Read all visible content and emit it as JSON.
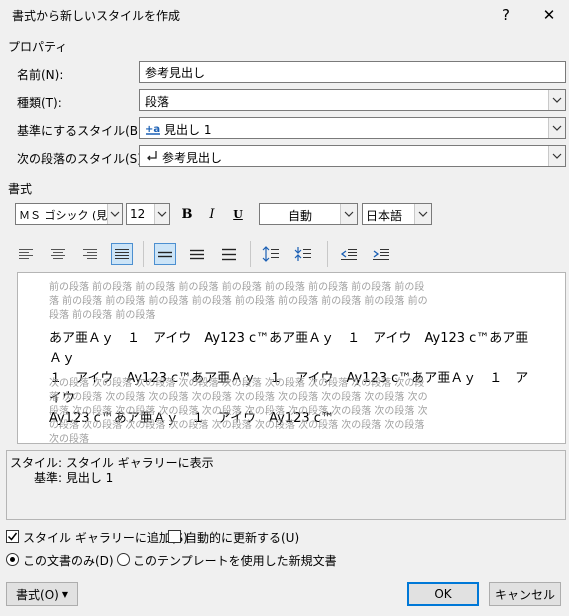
{
  "dialog": {
    "title": "書式から新しいスタイルを作成",
    "help": "?",
    "close": "✕"
  },
  "properties": {
    "heading": "プロパティ",
    "name_label": "名前(N):",
    "name_value": "参考見出し",
    "type_label": "種類(T):",
    "type_value": "段落",
    "based_on_label": "基準にするスタイル(B):",
    "based_on_value": "見出し 1",
    "next_label": "次の段落のスタイル(S):",
    "next_value": "参考見出し"
  },
  "formatting": {
    "heading": "書式",
    "font": "ＭＳ ゴシック (見出",
    "size": "12",
    "bold": "B",
    "italic": "I",
    "underline": "U",
    "color": "自動",
    "language": "日本語"
  },
  "preview": {
    "prev_para_lines": [
      "前の段落 前の段落 前の段落 前の段落 前の段落 前の段落 前の段落 前の段落 前の段",
      "落 前の段落 前の段落 前の段落 前の段落 前の段落 前の段落 前の段落 前の段落 前の",
      "段落 前の段落 前の段落"
    ],
    "sample_lines": [
      "あア亜Ａｙ　１　アイウ　Ay123 c™あア亜Ａｙ　１　アイウ　Ay123 c™あア亜Ａｙ",
      "１　アイウ　Ay123 c™あア亜Ａｙ　１　アイウ　Ay123 c™あア亜Ａｙ　１　アイウ",
      "Ay123 c™あア亜Ａｙ　１　アイウ　Ay123 c™"
    ],
    "next_para_lines": [
      "次の段落 次の段落 次の段落 次の段落 次の段落 次の段落 次の段落 次の段落 次の段",
      "落 次の段落 次の段落 次の段落 次の段落 次の段落 次の段落 次の段落 次の段落 次の",
      "段落 次の段落 次の段落 次の段落 次の段落 次の段落 次の段落 次の段落 次の段落 次",
      "の段落 次の段落 次の段落 次の段落 次の段落 次の段落 次の段落 次の段落 次の段落",
      "次の段落"
    ]
  },
  "description": {
    "line1": "スタイル: スタイル ギャラリーに表示",
    "line2": "基準: 見出し 1"
  },
  "options": {
    "add_gallery": "スタイル ギャラリーに追加(S)",
    "add_gallery_checked": true,
    "auto_update": "自動的に更新する(U)",
    "auto_update_checked": false,
    "this_doc": "この文書のみ(D)",
    "template": "このテンプレートを使用した新規文書",
    "selected": "this_doc"
  },
  "buttons": {
    "format": "書式(O)",
    "ok": "OK",
    "cancel": "キャンセル"
  },
  "colors": {
    "accent": "#0078d7",
    "toggle_bg": "#cce4f7"
  }
}
